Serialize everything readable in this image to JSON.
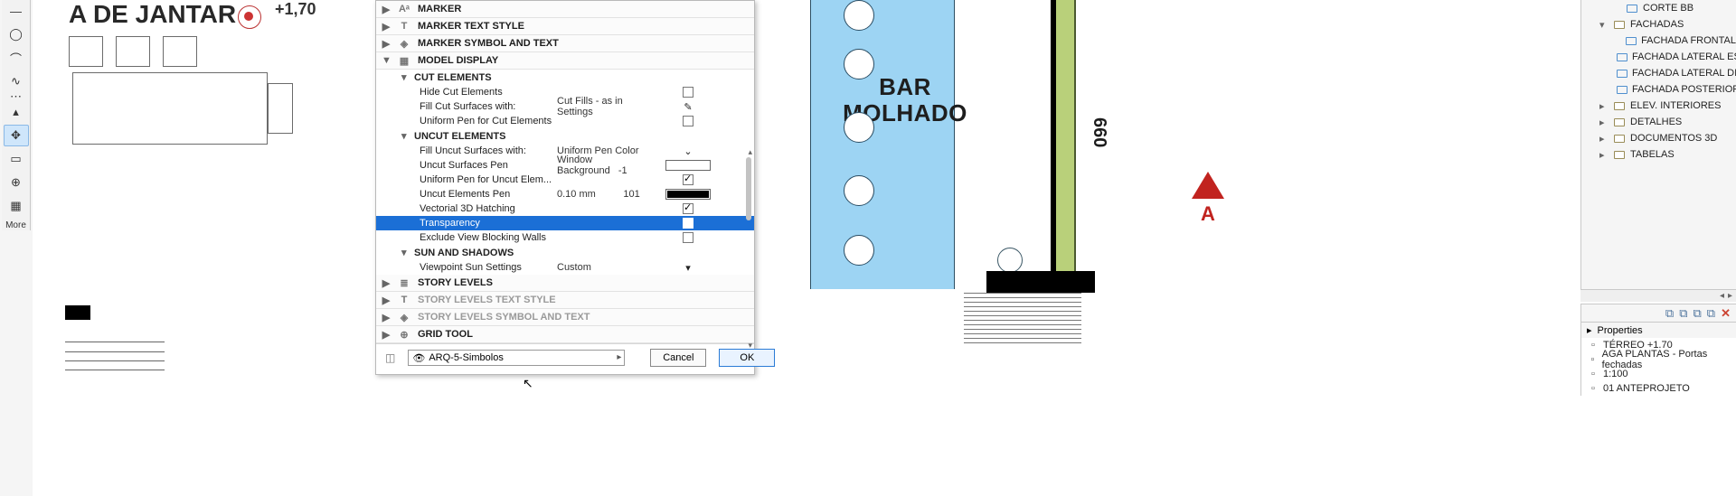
{
  "canvas": {
    "drawing_title": "A DE JANTAR",
    "elev_label": "+1,70",
    "bar_label_1": "BAR",
    "bar_label_2": "MOLHADO",
    "dim_660": "660",
    "north_letter": "A"
  },
  "left_toolbar": {
    "more_label": "More"
  },
  "dialog": {
    "sections": {
      "marker": "MARKER",
      "marker_text_style": "MARKER TEXT STYLE",
      "marker_symbol_and_text": "MARKER SYMBOL AND TEXT",
      "model_display": "MODEL DISPLAY",
      "story_levels": "STORY LEVELS",
      "story_levels_text_style": "STORY LEVELS TEXT STYLE",
      "story_levels_symbol_and_text": "STORY LEVELS SYMBOL AND TEXT",
      "grid_tool": "GRID TOOL"
    },
    "groups": {
      "cut_elements": "CUT ELEMENTS",
      "uncut_elements": "UNCUT ELEMENTS",
      "sun_and_shadows": "SUN AND SHADOWS"
    },
    "rows": {
      "hide_cut_elements": "Hide Cut Elements",
      "fill_cut_surfaces_with": "Fill Cut Surfaces with:",
      "fill_cut_surfaces_val": "Cut Fills - as in Settings",
      "uniform_pen_cut": "Uniform Pen for Cut Elements",
      "fill_uncut_surfaces_with": "Fill Uncut Surfaces with:",
      "fill_uncut_surfaces_val": "Uniform Pen Color",
      "uncut_surfaces_pen": "Uncut Surfaces Pen",
      "uncut_surfaces_pen_val": "Window Background",
      "uncut_surfaces_pen_num": "-1",
      "uniform_pen_uncut": "Uniform Pen for Uncut Elem...",
      "uncut_elements_pen": "Uncut Elements Pen",
      "uncut_elements_pen_val": "0.10 mm",
      "uncut_elements_pen_num": "101",
      "vectorial_3d_hatch": "Vectorial 3D Hatching",
      "transparency": "Transparency",
      "exclude_view_block": "Exclude View Blocking Walls",
      "viewpoint_sun": "Viewpoint Sun Settings",
      "viewpoint_sun_val": "Custom"
    },
    "footer": {
      "layer_combo": "ARQ-5-Simbolos",
      "cancel": "Cancel",
      "ok": "OK"
    }
  },
  "navigator": {
    "items": [
      {
        "kind": "view",
        "indent": 2,
        "label": "CORTE BB"
      },
      {
        "kind": "folder",
        "indent": 1,
        "label": "FACHADAS",
        "open": true
      },
      {
        "kind": "view",
        "indent": 2,
        "label": "FACHADA FRONTAL"
      },
      {
        "kind": "view",
        "indent": 2,
        "label": "FACHADA LATERAL ESQUER"
      },
      {
        "kind": "view",
        "indent": 2,
        "label": "FACHADA LATERAL DIREITA"
      },
      {
        "kind": "view",
        "indent": 2,
        "label": "FACHADA POSTERIOR"
      },
      {
        "kind": "folder",
        "indent": 1,
        "label": "ELEV. INTERIORES"
      },
      {
        "kind": "folder",
        "indent": 1,
        "label": "DETALHES"
      },
      {
        "kind": "folder",
        "indent": 1,
        "label": "DOCUMENTOS 3D"
      },
      {
        "kind": "folder",
        "indent": 1,
        "label": "TABELAS"
      }
    ]
  },
  "properties": {
    "title": "Properties",
    "rows": [
      "TÉRREO +1.70",
      "AGA PLANTAS - Portas fechadas",
      "1:100",
      "01 ANTEPROJETO"
    ]
  }
}
